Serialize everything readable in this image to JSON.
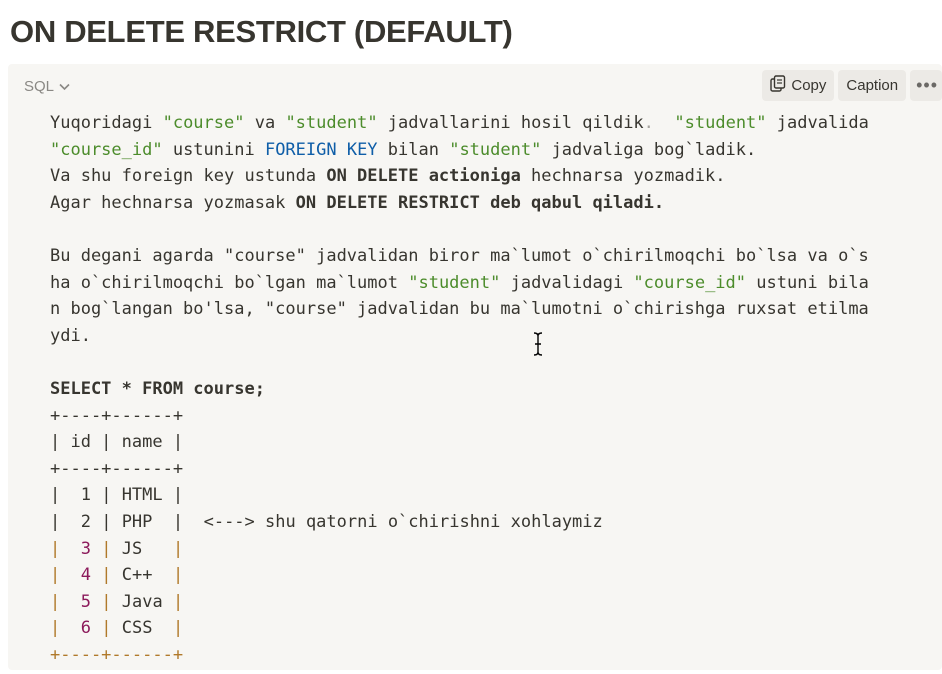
{
  "page": {
    "title": "ON DELETE RESTRICT (DEFAULT)"
  },
  "code_block": {
    "language": "SQL",
    "copy_label": "Copy",
    "caption_label": "Caption",
    "more_label": "•••",
    "intro": {
      "l1": {
        "a": "Yuqoridagi ",
        "b": "\"course\"",
        "c": " va ",
        "d": "\"student\"",
        "e": " jadvallarini hosil qildik",
        "f": ".",
        "g": "  ",
        "h": "\"student\"",
        "i": " jadvalida"
      },
      "l2": {
        "a": "\"course_id\"",
        "b": " ustunini ",
        "c": "FOREIGN KEY",
        "d": " bilan ",
        "e": "\"student\"",
        "f": " jadvaliga bog`ladik."
      },
      "l3": {
        "a": "Va shu foreign key ustunda ",
        "b": "ON DELETE actioniga",
        "c": " hechnarsa yozmadik."
      },
      "l4": {
        "a": "Agar hechnarsa yozmasak ",
        "b": "ON DELETE RESTRICT deb qabul qiladi."
      }
    },
    "para": {
      "l1": "Bu degani agarda \"course\" jadvalidan biror ma`lumot o`chirilmoqchi bo`lsa va o`s",
      "l2": {
        "a": "ha o`chirilmoqchi bo`lgan ma`lumot ",
        "b": "\"student\"",
        "c": " jadvalidagi ",
        "d": "\"course_id\"",
        "e": " ustuni bila"
      },
      "l3": "n bog`langan bo'lsa, \"course\" jadvalidan bu ma`lumotni o`chirishga ruxsat etilma",
      "l4": "ydi."
    },
    "query": "SELECT * FROM course;",
    "table": {
      "border": "+----+------+",
      "header": "| id | name |",
      "rows": [
        {
          "id": "1",
          "name": "HTML"
        },
        {
          "id": "2",
          "name": "PHP ",
          "note": "  <---> shu qatorni o`chirishni xohlaymiz"
        },
        {
          "id": "3",
          "name": "JS  "
        },
        {
          "id": "4",
          "name": "C++ "
        },
        {
          "id": "5",
          "name": "Java"
        },
        {
          "id": "6",
          "name": "CSS "
        }
      ]
    }
  }
}
